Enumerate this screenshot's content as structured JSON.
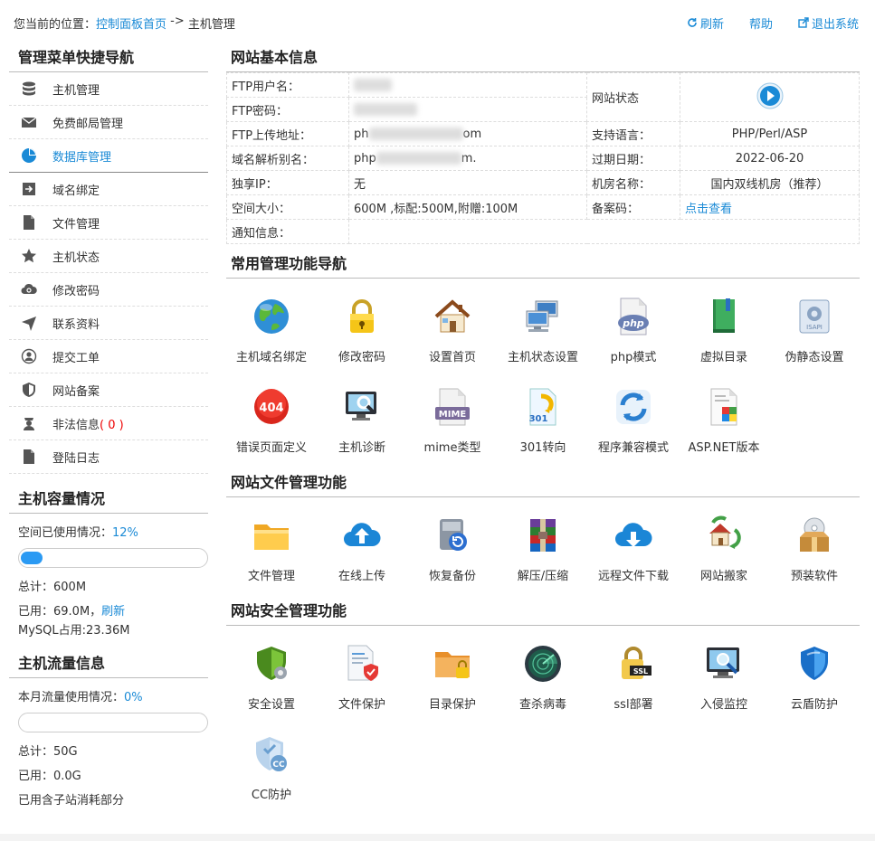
{
  "breadcrumb": {
    "prefix": "您当前的位置：",
    "home": "控制面板首页",
    "sep": " -> ",
    "current": "主机管理"
  },
  "top_actions": {
    "refresh": "刷新",
    "help": "帮助",
    "logout": "退出系统"
  },
  "sidebar": {
    "title": "管理菜单快捷导航",
    "items": [
      {
        "label": "主机管理",
        "icon": "database-icon"
      },
      {
        "label": "免费邮局管理",
        "icon": "mail-icon"
      },
      {
        "label": "数据库管理",
        "icon": "pie-icon",
        "active": true
      },
      {
        "label": "域名绑定",
        "icon": "login-icon"
      },
      {
        "label": "文件管理",
        "icon": "file-icon"
      },
      {
        "label": "主机状态",
        "icon": "star-icon"
      },
      {
        "label": "修改密码",
        "icon": "cloud-icon"
      },
      {
        "label": "联系资料",
        "icon": "send-icon"
      },
      {
        "label": "提交工单",
        "icon": "user-icon"
      },
      {
        "label": "网站备案",
        "icon": "shield-icon"
      },
      {
        "label": "非法信息",
        "icon": "police-icon",
        "count": "( 0 )"
      },
      {
        "label": "登陆日志",
        "icon": "file-icon"
      }
    ]
  },
  "capacity": {
    "title": "主机容量情况",
    "usage_label": "空间已使用情况：",
    "usage_pct": "12%",
    "usage_fraction": 0.12,
    "total": "总计：600M",
    "used": "已用：69.0M，",
    "refresh": "刷新",
    "mysql": "MySQL占用:23.36M"
  },
  "traffic": {
    "title": "主机流量信息",
    "usage_label": "本月流量使用情况：",
    "usage_pct": "0%",
    "usage_fraction": 0.0,
    "total": "总计：50G",
    "used": "已用：0.0G",
    "note": "已用含子站消耗部分"
  },
  "basic_info": {
    "title": "网站基本信息",
    "ftp_user_label": "FTP用户名：",
    "ftp_pass_label": "FTP密码：",
    "site_status_label": "网站状态",
    "ftp_addr_label": "FTP上传地址：",
    "ftp_addr_prefix": "ph",
    "ftp_addr_suffix": "om",
    "lang_label": "支持语言：",
    "lang_value": "PHP/Perl/ASP",
    "alias_label": "域名解析别名：",
    "alias_prefix": "php",
    "alias_suffix": "m.",
    "expire_label": "过期日期：",
    "expire_value": "2022-06-20",
    "ip_label": "独享IP：",
    "ip_value": "无",
    "room_label": "机房名称：",
    "room_value": "国内双线机房（推荐）",
    "space_label": "空间大小：",
    "space_value": "600M ,标配:500M,附赠:100M",
    "beian_label": "备案码：",
    "beian_value": "点击查看",
    "notice_label": "通知信息："
  },
  "common": {
    "title": "常用管理功能导航",
    "items": [
      {
        "label": "主机域名绑定",
        "icon": "globe-icon"
      },
      {
        "label": "修改密码",
        "icon": "padlock-icon"
      },
      {
        "label": "设置首页",
        "icon": "house-icon"
      },
      {
        "label": "主机状态设置",
        "icon": "computers-icon"
      },
      {
        "label": "php模式",
        "icon": "php-icon"
      },
      {
        "label": "虚拟目录",
        "icon": "book-icon"
      },
      {
        "label": "伪静态设置",
        "icon": "isapi-icon"
      },
      {
        "label": "错误页面定义",
        "icon": "error-404-icon"
      },
      {
        "label": "主机诊断",
        "icon": "monitor-search-icon"
      },
      {
        "label": "mime类型",
        "icon": "mime-icon"
      },
      {
        "label": "301转向",
        "icon": "redirect-301-icon"
      },
      {
        "label": "程序兼容模式",
        "icon": "refresh-arrows-icon"
      },
      {
        "label": "ASP.NET版本",
        "icon": "aspnet-icon"
      }
    ]
  },
  "files": {
    "title": "网站文件管理功能",
    "items": [
      {
        "label": "文件管理",
        "icon": "folder-icon"
      },
      {
        "label": "在线上传",
        "icon": "cloud-upload-icon"
      },
      {
        "label": "恢复备份",
        "icon": "disk-restore-icon"
      },
      {
        "label": "解压/压缩",
        "icon": "archive-icon"
      },
      {
        "label": "远程文件下载",
        "icon": "cloud-download-icon"
      },
      {
        "label": "网站搬家",
        "icon": "move-house-icon"
      },
      {
        "label": "预装软件",
        "icon": "software-box-icon"
      }
    ]
  },
  "security": {
    "title": "网站安全管理功能",
    "items": [
      {
        "label": "安全设置",
        "icon": "security-shield-icon"
      },
      {
        "label": "文件保护",
        "icon": "file-protect-icon"
      },
      {
        "label": "目录保护",
        "icon": "folder-lock-icon"
      },
      {
        "label": "查杀病毒",
        "icon": "radar-icon"
      },
      {
        "label": "ssl部署",
        "icon": "ssl-lock-icon"
      },
      {
        "label": "入侵监控",
        "icon": "monitor-magnifier-icon"
      },
      {
        "label": "云盾防护",
        "icon": "cloud-shield-icon"
      },
      {
        "label": "CC防护",
        "icon": "cc-shield-icon"
      }
    ]
  },
  "colors": {
    "accent": "#1a8ad6",
    "bar_fill": "#2b9af3",
    "alert": "#ee0000"
  }
}
